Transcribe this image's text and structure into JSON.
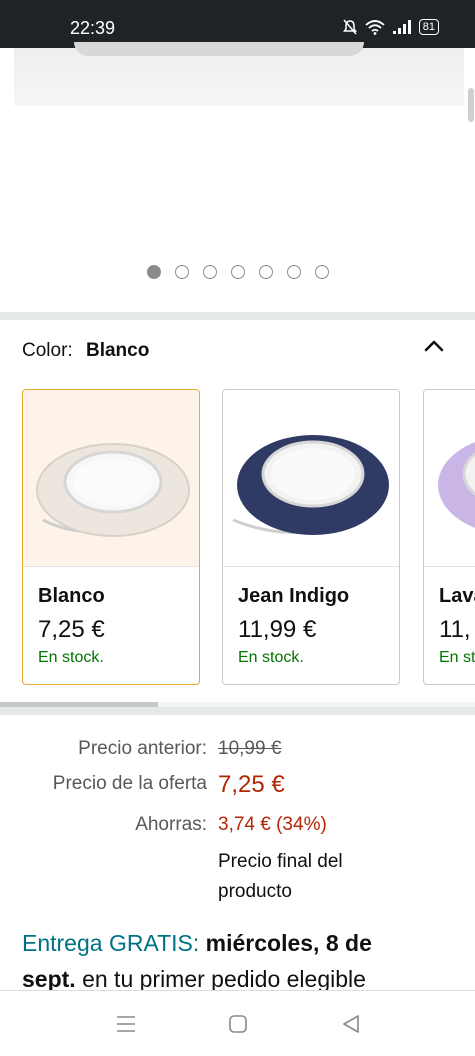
{
  "status_bar": {
    "time": "22:39",
    "battery": "81"
  },
  "gallery": {
    "dot_count": 7,
    "active_index": 0
  },
  "color_selector": {
    "label": "Color:",
    "selected": "Blanco"
  },
  "swatches": [
    {
      "name": "Blanco",
      "price": "7,25 €",
      "stock": "En stock.",
      "selected": true,
      "color": "#ece6de"
    },
    {
      "name": "Jean Indigo",
      "price": "11,99 €",
      "stock": "En stock.",
      "selected": false,
      "color": "#2f3b64"
    },
    {
      "name": "Lava",
      "price": "11,",
      "stock": "En st",
      "selected": false,
      "color": "#c9b6e6"
    }
  ],
  "pricing": {
    "previous_label": "Precio anterior:",
    "previous_value": "10,99 €",
    "deal_label": "Precio de la oferta",
    "deal_value": "7,25 €",
    "savings_label": "Ahorras:",
    "savings_value": "3,74 € (34%)",
    "final_note": "Precio final del producto"
  },
  "delivery": {
    "free_text": "Entrega GRATIS:",
    "date_bold_1": "miércoles, 8 de",
    "date_bold_2": "sept.",
    "rest": "en tu primer pedido elegible"
  },
  "colors": {
    "accent_selected": "#e8a930",
    "stock_green": "#007600",
    "price_red": "#b12704",
    "link_teal": "#007185"
  },
  "nav_icons": [
    "menu-icon",
    "home-square-icon",
    "back-triangle-icon"
  ]
}
